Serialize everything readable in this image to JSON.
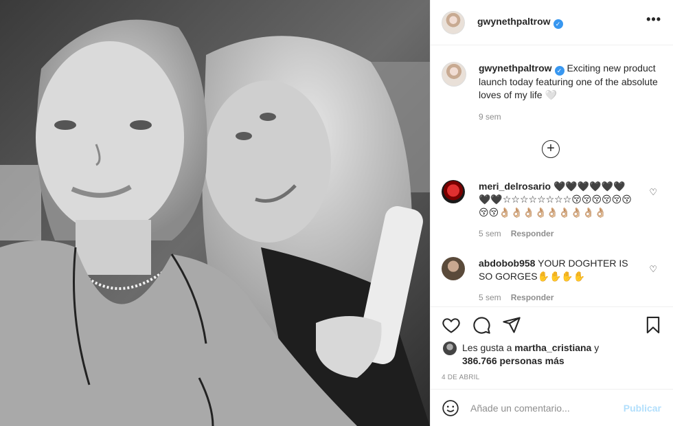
{
  "post": {
    "author": "gwynethpaltrow",
    "more_icon": "more-options-icon",
    "caption_text": " Exciting new product launch today featuring one of the absolute loves of my life 🤍",
    "caption_time": "9 sem"
  },
  "comments": [
    {
      "username": "meri_delrosario",
      "text": " 🖤🖤🖤🖤🖤🖤🖤🖤☆☆☆☆☆☆☆☆😚😚😚😚😚😚😚😚👌🏼👌🏼👌🏼👌🏼👌🏼👌🏼👌🏼👌🏼👌🏼",
      "time": "5 sem",
      "reply": "Responder"
    },
    {
      "username": "abdobob958",
      "text": " YOUR DOGHTER IS SO GORGES✋✋✋✋",
      "time": "5 sem",
      "reply": "Responder"
    }
  ],
  "likes": {
    "prefix": "Les gusta a ",
    "user": "martha_cristiana",
    "middle": " y ",
    "count": "386.766 personas más"
  },
  "date": "4 DE ABRIL",
  "add_comment": {
    "placeholder": "Añade un comentario...",
    "publish": "Publicar"
  },
  "colors": {
    "accent_blue": "#3897f0",
    "publish_disabled": "#b2dffc",
    "muted_text": "#8e8e8e",
    "border": "#efefef"
  }
}
